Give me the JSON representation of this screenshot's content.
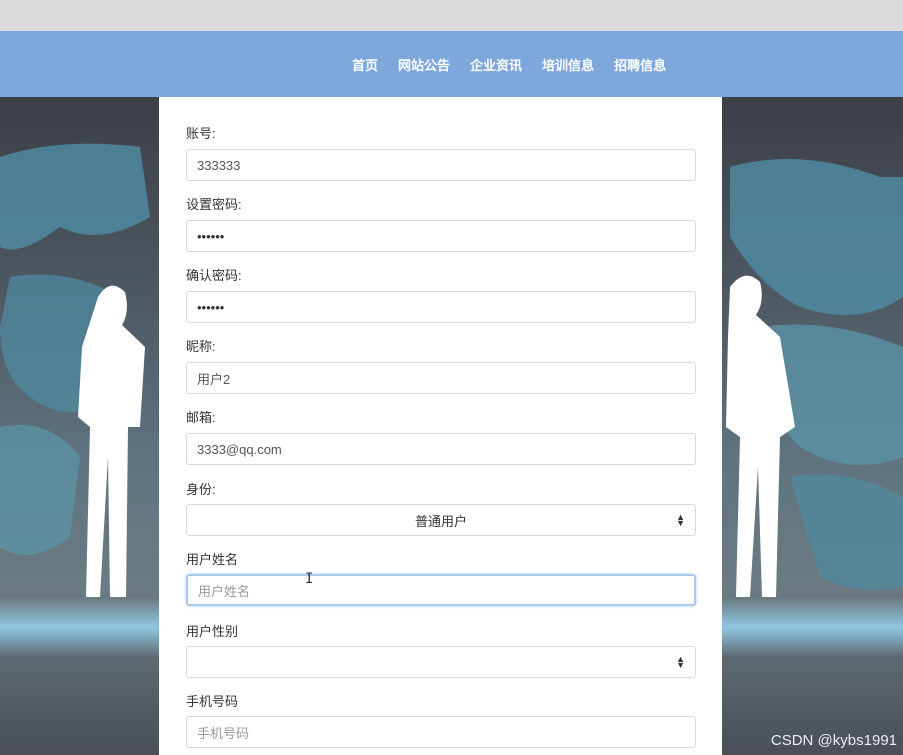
{
  "nav": {
    "items": [
      "首页",
      "网站公告",
      "企业资讯",
      "培训信息",
      "招聘信息"
    ]
  },
  "form": {
    "account": {
      "label": "账号:",
      "value": "333333"
    },
    "password": {
      "label": "设置密码:",
      "value": "••••••"
    },
    "confirm_password": {
      "label": "确认密码:",
      "value": "••••••"
    },
    "nickname": {
      "label": "昵称:",
      "value": "用户2"
    },
    "email": {
      "label": "邮箱:",
      "value": "3333@qq.com"
    },
    "identity": {
      "label": "身份:",
      "value": "普通用户"
    },
    "real_name": {
      "label": "用户姓名",
      "placeholder": "用户姓名"
    },
    "gender": {
      "label": "用户性别",
      "value": ""
    },
    "phone": {
      "label": "手机号码",
      "placeholder": "手机号码"
    }
  },
  "watermark": "CSDN @kybs1991",
  "colors": {
    "navbar": "#7ea8dc",
    "topbar": "#dadada"
  }
}
